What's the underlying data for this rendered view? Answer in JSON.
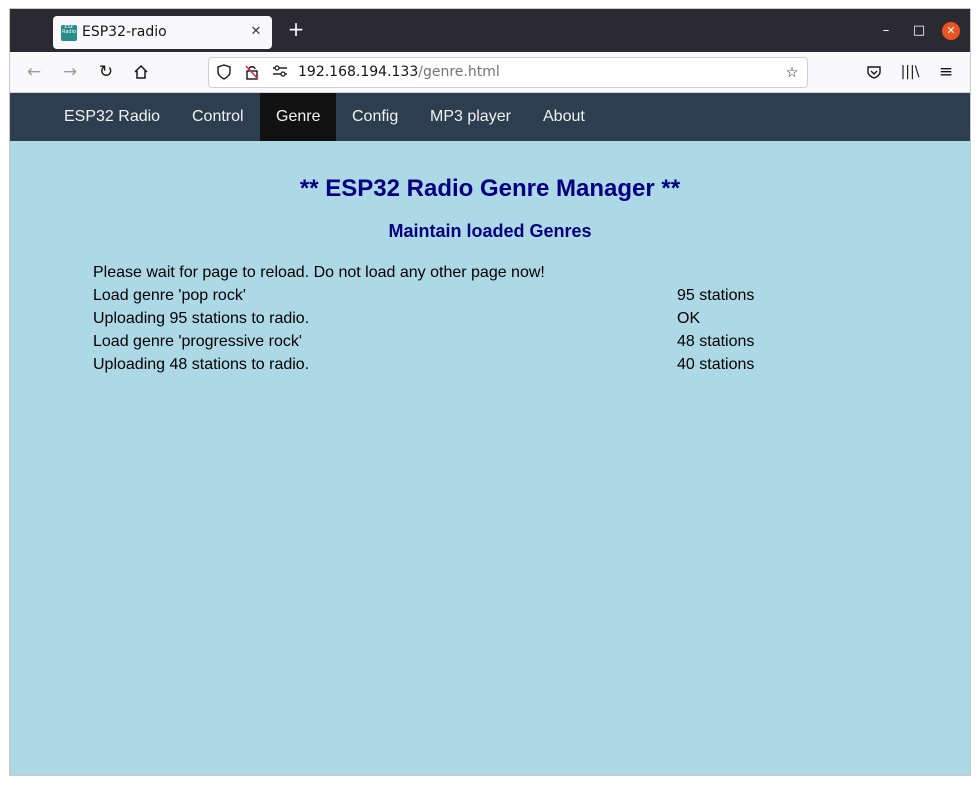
{
  "browser": {
    "tab_title": "ESP32-radio",
    "favicon_text": "ESP Radio",
    "new_tab": "+",
    "url_host": "192.168.194.133",
    "url_path": "/genre.html"
  },
  "nav": {
    "items": [
      {
        "label": "ESP32 Radio"
      },
      {
        "label": "Control"
      },
      {
        "label": "Genre",
        "active": true
      },
      {
        "label": "Config"
      },
      {
        "label": "MP3 player"
      },
      {
        "label": "About"
      }
    ]
  },
  "page": {
    "title": "** ESP32 Radio Genre Manager **",
    "subtitle": "Maintain loaded Genres",
    "log": [
      {
        "message": "Please wait for page to reload. Do not load any other page now!",
        "result": ""
      },
      {
        "message": "Load genre 'pop rock'",
        "result": "95 stations"
      },
      {
        "message": "Uploading 95 stations to radio.",
        "result": "OK"
      },
      {
        "message": "Load genre 'progressive rock'",
        "result": "48 stations"
      },
      {
        "message": "Uploading 48 stations to radio.",
        "result": "40 stations"
      }
    ]
  },
  "colors": {
    "page_background": "#add8e6",
    "nav_background": "#2c3e50",
    "nav_active": "#111111",
    "heading": "#000080"
  }
}
